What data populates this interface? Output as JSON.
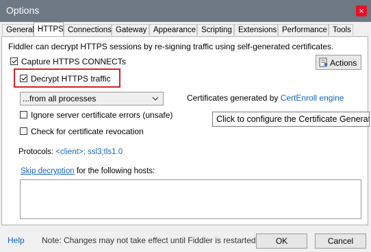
{
  "window": {
    "title": "Options",
    "close_glyph": "×"
  },
  "tabs": [
    {
      "label": "General"
    },
    {
      "label": "HTTPS"
    },
    {
      "label": "Connections"
    },
    {
      "label": "Gateway"
    },
    {
      "label": "Appearance"
    },
    {
      "label": "Scripting"
    },
    {
      "label": "Extensions"
    },
    {
      "label": "Performance"
    },
    {
      "label": "Tools"
    }
  ],
  "https": {
    "description": "Fiddler can decrypt HTTPS sessions by re-signing traffic using self-generated certificates.",
    "capture_label": "Capture HTTPS CONNECTs",
    "capture_checked": true,
    "decrypt_label": "Decrypt HTTPS traffic",
    "decrypt_checked": true,
    "actions_label": "Actions",
    "process_filter_value": "...from all processes",
    "cert_generated_prefix": "Certificates generated by",
    "cert_generated_link": "CertEnroll engine",
    "ignore_errors_label": "Ignore server certificate errors (unsafe)",
    "ignore_errors_checked": false,
    "revocation_label": "Check for certificate revocation",
    "revocation_checked": false,
    "protocols_label": "Protocols:",
    "protocols_value": "<client>; ssl3;tls1.0",
    "tooltip": "Click to configure the Certificate Generator",
    "skip_decryption_link": "Skip decryption",
    "skip_decryption_suffix": "for the following hosts:",
    "hosts_value": ""
  },
  "footer": {
    "help_label": "Help",
    "note": "Note: Changes may not take effect until Fiddler is restarted.",
    "ok_label": "OK",
    "cancel_label": "Cancel"
  },
  "colors": {
    "titlebar": "#6d7a86",
    "close": "#e81123",
    "link": "#1565c0",
    "highlight_box": "#d32027"
  },
  "icons": {
    "actions": "certificate-actions-icon",
    "dropdown": "chevron-down-icon",
    "close": "close-icon"
  }
}
